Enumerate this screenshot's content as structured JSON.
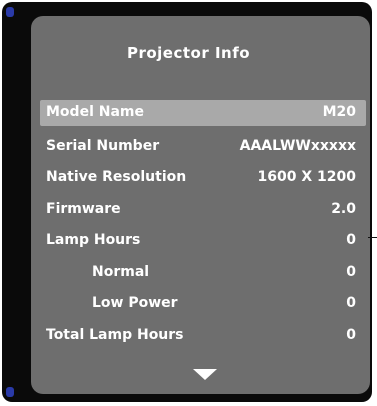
{
  "menu": {
    "title": "Projector Info",
    "rows": [
      {
        "label": "Model Name",
        "value": "M20"
      },
      {
        "label": "Serial Number",
        "value": "AAALWWxxxxx"
      },
      {
        "label": "Native Resolution",
        "value": "1600 X 1200"
      },
      {
        "label": "Firmware",
        "value": "2.0"
      },
      {
        "label": "Lamp Hours",
        "value": "0"
      },
      {
        "label": "Normal",
        "value": "0"
      },
      {
        "label": "Low Power",
        "value": "0"
      },
      {
        "label": "Total Lamp Hours",
        "value": "0"
      }
    ],
    "selected_row": "Model Name",
    "scroll_indicator": "down-triangle-icon"
  },
  "colors": {
    "frame": "#0a0a0a",
    "panel": "#6e6e6e",
    "selection": "#a9a9a9",
    "text": "#ffffff",
    "accent": "#2a3aa8"
  }
}
